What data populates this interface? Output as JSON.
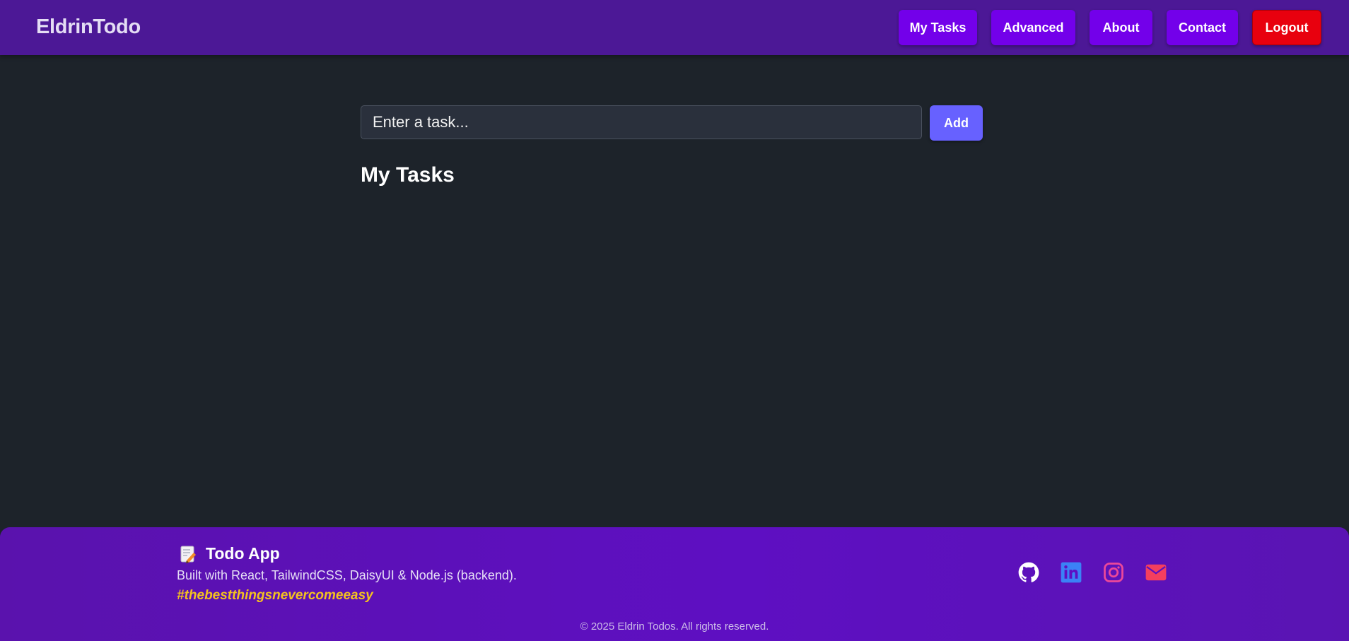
{
  "navbar": {
    "brand": "EldrinTodo",
    "links": [
      {
        "label": "My Tasks"
      },
      {
        "label": "Advanced"
      },
      {
        "label": "About"
      },
      {
        "label": "Contact"
      }
    ],
    "logout_label": "Logout"
  },
  "main": {
    "task_input": {
      "value": "",
      "placeholder": "Enter a task..."
    },
    "add_label": "Add",
    "section_title": "My Tasks",
    "tasks": []
  },
  "footer": {
    "brand_icon": "memo-icon",
    "brand_title": "Todo App",
    "description": "Built with React, TailwindCSS, DaisyUI & Node.js (backend).",
    "tagline": "#thebestthingsnevercomeeasy",
    "social": [
      {
        "icon": "github-icon",
        "color": "#ffffff"
      },
      {
        "icon": "linkedin-icon",
        "color": "#3b82f6"
      },
      {
        "icon": "instagram-icon",
        "color": "#ec4899"
      },
      {
        "icon": "email-icon",
        "color": "#f43f5e"
      }
    ],
    "copyright": "© 2025 Eldrin Todos. All rights reserved."
  },
  "colors": {
    "navbar_bg": "#4c1896",
    "nav_button": "#7300ea",
    "logout_button": "#e8000e",
    "page_bg": "#1d232a",
    "add_button": "#6761ff",
    "footer_bg": "#5e0fc2",
    "tagline": "#f4c21f"
  }
}
